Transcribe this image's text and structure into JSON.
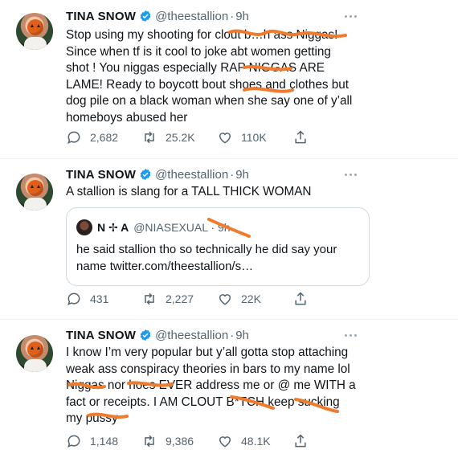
{
  "tweets": [
    {
      "name": "TINA SNOW",
      "handle": "@theestallion",
      "sep": "·",
      "time": "9h",
      "text": "Stop using my shooting for clout b…h ass Niggas!\nSince when tf is it cool to joke abt women getting\nshot ! You niggas especially RAP NIGGAS ARE\nLAME! Ready to boycott bout shoes and clothes but\ndog pile on a black woman when she say one of y’all\nhomeboys abused her",
      "replies": "2,682",
      "retweets": "25.2K",
      "likes": "110K"
    },
    {
      "name": "TINA SNOW",
      "handle": "@theestallion",
      "sep": "·",
      "time": "9h",
      "text": "A stallion is slang for a TALL THICK WOMAN",
      "quote": {
        "name": "N ✢ A",
        "handle": "@NIASEXUAL · 9h",
        "text": "he said stallion tho so technically he did say your\nname twitter.com/theestallion/s…"
      },
      "replies": "431",
      "retweets": "2,227",
      "likes": "22K"
    },
    {
      "name": "TINA SNOW",
      "handle": "@theestallion",
      "sep": "·",
      "time": "9h",
      "text": "I know I’m very popular but y’all gotta stop attaching\nweak ass conspiracy theories in bars to my name lol\nNiggas nor hoes EVER address me or @ me WITH a\nfact or receipts. I AM CLOUT B*TCH keep sucking\nmy pussy",
      "replies": "1,148",
      "retweets": "9,386",
      "likes": "48.1K"
    }
  ],
  "colors": {
    "text": "#0f1419",
    "muted": "#536471",
    "verified": "#1d9bf0",
    "scribble": "#f07b2c",
    "border": "#cfd9de"
  },
  "icons": [
    "verified-badge-icon",
    "more-icon",
    "reply-icon",
    "retweet-icon",
    "like-icon",
    "share-icon"
  ]
}
